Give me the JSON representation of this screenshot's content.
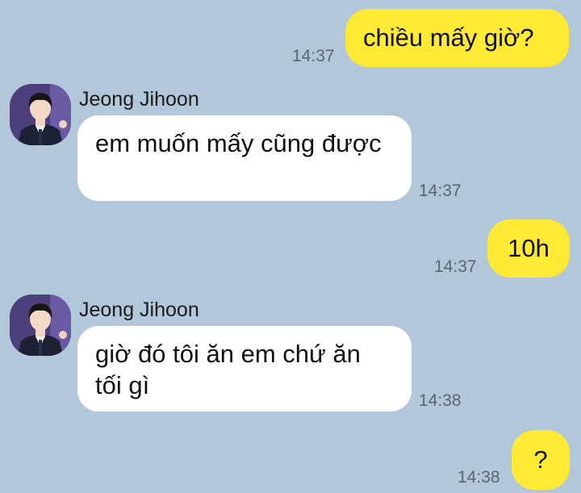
{
  "chat": {
    "messages": [
      {
        "from": "me",
        "text": "chiều mấy giờ?",
        "time": "14:37"
      },
      {
        "from": "other",
        "sender": "Jeong Jihoon",
        "avatar": "profile-photo",
        "text": "em muốn mấy cũng được",
        "time": "14:37"
      },
      {
        "from": "me",
        "text": "10h",
        "time": "14:37"
      },
      {
        "from": "other",
        "sender": "Jeong Jihoon",
        "avatar": "profile-photo",
        "text": "giờ đó tôi ăn em chứ ăn tối gì",
        "time": "14:38"
      },
      {
        "from": "me",
        "text": "?",
        "time": "14:38"
      }
    ]
  },
  "colors": {
    "background": "#b2c7da",
    "my_bubble": "#fee934",
    "other_bubble": "#ffffff",
    "timestamp": "#5b6670"
  }
}
